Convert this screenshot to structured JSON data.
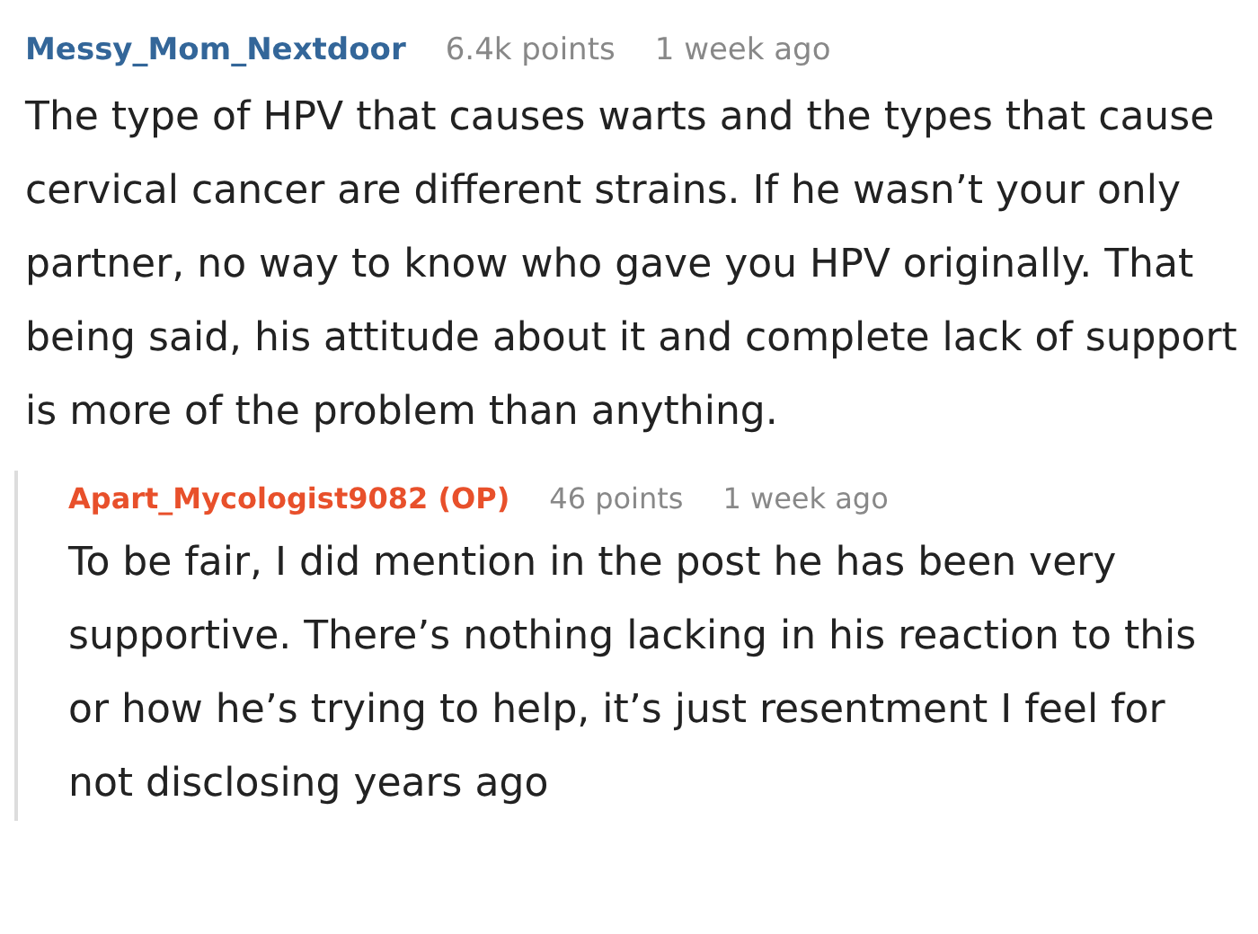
{
  "comments": [
    {
      "author": "Messy_Mom_Nextdoor",
      "is_op": false,
      "points": "6.4k points",
      "time": "1 week ago",
      "body": "The type of HPV that causes warts and the types that cause cervical cancer are different strains. If he wasn’t your only partner, no way to know who gave you HPV originally. That being said, his attitude about it and complete lack of support is more of the problem than anything.",
      "replies": [
        {
          "author": "Apart_Mycologist9082 (OP)",
          "is_op": true,
          "points": "46 points",
          "time": "1 week ago",
          "body": "To be fair, I did mention in the post he has been very supportive. There’s nothing lacking in his reaction to this or how he’s trying to help, it’s just resentment I feel for not disclosing years ago"
        }
      ]
    }
  ]
}
